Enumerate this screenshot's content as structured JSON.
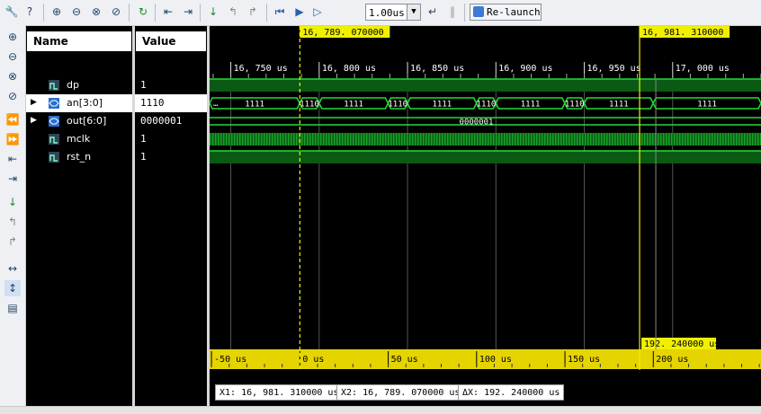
{
  "toolbar": {
    "zoom_value": "1.00us",
    "relaunch_label": "Re-launch"
  },
  "headers": {
    "name": "Name",
    "value": "Value"
  },
  "signals": [
    {
      "name": "dp",
      "value": "1",
      "type": "bit",
      "expandable": false
    },
    {
      "name": "an[3:0]",
      "value": "1110",
      "type": "bus",
      "expandable": true,
      "selected": true
    },
    {
      "name": "out[6:0]",
      "value": "0000001",
      "type": "bus",
      "expandable": true
    },
    {
      "name": "mclk",
      "value": "1",
      "type": "bit",
      "expandable": false
    },
    {
      "name": "rst_n",
      "value": "1",
      "type": "bit",
      "expandable": false
    }
  ],
  "timeline": {
    "top_labels": [
      "16, 750 us",
      "16, 800 us",
      "16, 850 us",
      "16, 900 us",
      "16, 950 us",
      "17, 000 us"
    ],
    "bottom_labels": [
      "-50 us",
      "0 us",
      "50 us",
      "100 us",
      "150 us",
      "200 us"
    ],
    "top_span_us": [
      16738.0,
      17050.0
    ],
    "cursor_x1_us": 16981.31,
    "cursor_x2_us": 16789.07,
    "cursor_x1_label": "16, 981. 310000 us",
    "cursor_x2_label": "16, 789. 070000 us",
    "delta_label": "192. 240000 us"
  },
  "an_bus": {
    "overflow_label": "…",
    "segments": [
      {
        "value": "1111",
        "from_us": 16738.0,
        "to_us": 16789.0
      },
      {
        "value": "1110",
        "from_us": 16789.0,
        "to_us": 16800.0
      },
      {
        "value": "1111",
        "from_us": 16800.0,
        "to_us": 16839.0
      },
      {
        "value": "1110",
        "from_us": 16839.0,
        "to_us": 16850.0
      },
      {
        "value": "1111",
        "from_us": 16850.0,
        "to_us": 16889.0
      },
      {
        "value": "1110",
        "from_us": 16889.0,
        "to_us": 16900.0
      },
      {
        "value": "1111",
        "from_us": 16900.0,
        "to_us": 16939.0
      },
      {
        "value": "1110",
        "from_us": 16939.0,
        "to_us": 16950.0
      },
      {
        "value": "1111",
        "from_us": 16950.0,
        "to_us": 16989.0
      },
      {
        "value": "1111",
        "from_us": 16989.0,
        "to_us": 17050.0
      }
    ]
  },
  "out_bus_value": "0000001",
  "status": {
    "x1": "X1: 16, 981. 310000 us",
    "x2": "X2: 16, 789. 070000 us",
    "dx": "ΔX: 192. 240000 us"
  },
  "colors": {
    "wave_green": "#22dd33",
    "wave_fill": "#0a5a14",
    "cursor_yellow": "#f0f000",
    "ruler_yellow": "#e6d400",
    "background": "#000000"
  }
}
